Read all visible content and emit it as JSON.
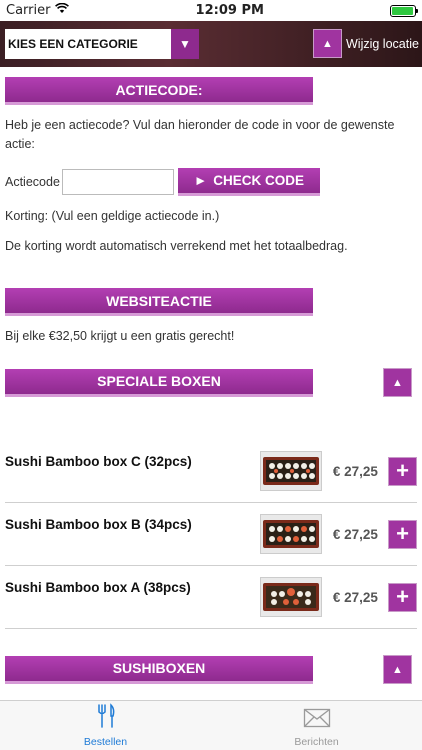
{
  "status": {
    "carrier": "Carrier",
    "time": "12:09 PM",
    "battery_level": 0.95
  },
  "header": {
    "category_placeholder": "KIES EEN CATEGORIE",
    "change_location": "Wijzig locatie"
  },
  "actiecode": {
    "title": "ACTIECODE:",
    "intro": "Heb je een actiecode? Vul dan hieronder de code in voor de gewenste actie:",
    "input_label": "Actiecode",
    "input_value": "",
    "check_button": "CHECK CODE",
    "korting": "Korting: (Vul een geldige actiecode in.)",
    "note": "De korting wordt automatisch verrekend met het totaalbedrag."
  },
  "websiteactie": {
    "title": "WEBSITEACTIE",
    "text": "Bij elke €32,50 krijgt u een gratis gerecht!"
  },
  "speciale_boxen": {
    "title": "SPECIALE BOXEN",
    "products": [
      {
        "name": "Sushi Bamboo box C (32pcs)",
        "price": "€ 27,25"
      },
      {
        "name": "Sushi Bamboo box B (34pcs)",
        "price": "€ 27,25"
      },
      {
        "name": "Sushi Bamboo box A (38pcs)",
        "price": "€ 27,25"
      }
    ]
  },
  "sushiboxen": {
    "title": "SUSHIBOXEN"
  },
  "tabs": [
    {
      "label": "Bestellen",
      "icon": "fork-knife-icon",
      "active": true
    },
    {
      "label": "Berichten",
      "icon": "envelope-icon",
      "active": false
    }
  ],
  "colors": {
    "accent": "#a034a0",
    "tab_active": "#1f7bd6"
  }
}
